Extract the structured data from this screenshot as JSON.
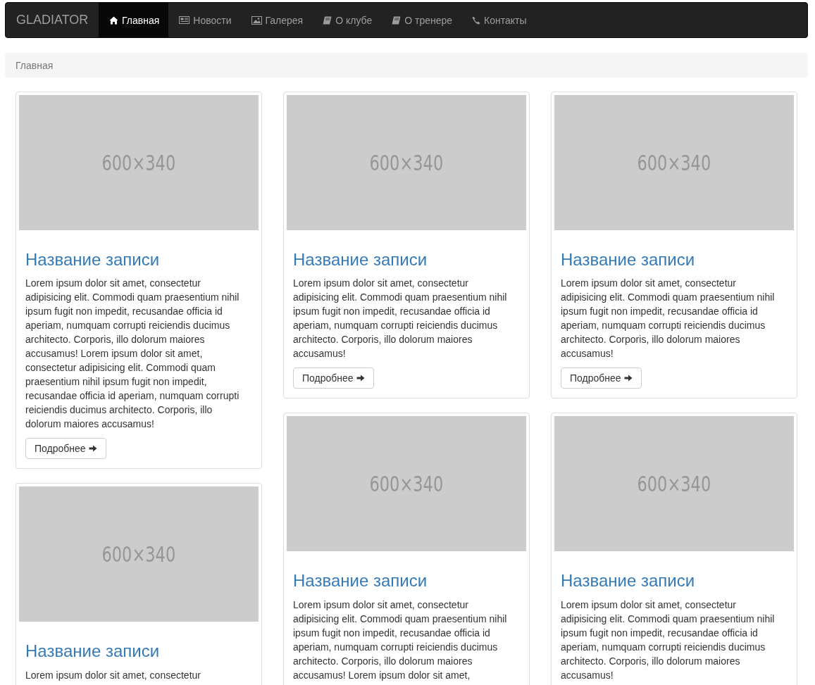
{
  "navbar": {
    "brand": "GLADIATOR",
    "items": [
      {
        "label": "Главная",
        "kind": "home",
        "selected": true
      },
      {
        "label": "Новости",
        "kind": "news",
        "selected": false
      },
      {
        "label": "Галерея",
        "kind": "gallery",
        "selected": false
      },
      {
        "label": "О клубе",
        "kind": "info",
        "selected": false
      },
      {
        "label": "О тренере",
        "kind": "info",
        "selected": false
      },
      {
        "label": "Контакты",
        "kind": "contact",
        "selected": false
      }
    ]
  },
  "breadcrumb": [
    "Главная"
  ],
  "columns": [
    [
      {
        "image_label": "600×340",
        "title": "Название записи",
        "text": "Lorem ipsum dolor sit amet, consectetur adipisicing elit. Commodi quam praesentium nihil ipsum fugit non impedit, recusandae officia id aperiam, numquam corrupti reiciendis ducimus architecto. Corporis, illo dolorum maiores accusamus! Lorem ipsum dolor sit amet, consectetur adipisicing elit. Commodi quam praesentium nihil ipsum fugit non impedit, recusandae officia id aperiam, numquam corrupti reiciendis ducimus architecto. Corporis, illo dolorum maiores accusamus!",
        "button": "Подробнее"
      },
      {
        "image_label": "600×340",
        "title": "Название записи",
        "text": "Lorem ipsum dolor sit amet, consectetur"
      }
    ],
    [
      {
        "image_label": "600×340",
        "title": "Название записи",
        "text": "Lorem ipsum dolor sit amet, consectetur adipisicing elit. Commodi quam praesentium nihil ipsum fugit non impedit, recusandae officia id aperiam, numquam corrupti reiciendis ducimus architecto. Corporis, illo dolorum maiores accusamus!",
        "button": "Подробнее"
      },
      {
        "image_label": "600×340",
        "title": "Название записи",
        "text": "Lorem ipsum dolor sit amet, consectetur adipisicing elit. Commodi quam praesentium nihil ipsum fugit non impedit, recusandae officia id aperiam, numquam corrupti reiciendis ducimus architecto. Corporis, illo dolorum maiores accusamus! Lorem ipsum dolor sit amet,"
      }
    ],
    [
      {
        "image_label": "600×340",
        "title": "Название записи",
        "text": "Lorem ipsum dolor sit amet, consectetur adipisicing elit. Commodi quam praesentium nihil ipsum fugit non impedit, recusandae officia id aperiam, numquam corrupti reiciendis ducimus architecto. Corporis, illo dolorum maiores accusamus!",
        "button": "Подробнее"
      },
      {
        "image_label": "600×340",
        "title": "Название записи",
        "text": "Lorem ipsum dolor sit amet, consectetur adipisicing elit. Commodi quam praesentium nihil ipsum fugit non impedit, recusandae officia id aperiam, numquam corrupti reiciendis ducimus architecto. Corporis, illo dolorum maiores accusamus!"
      }
    ]
  ]
}
